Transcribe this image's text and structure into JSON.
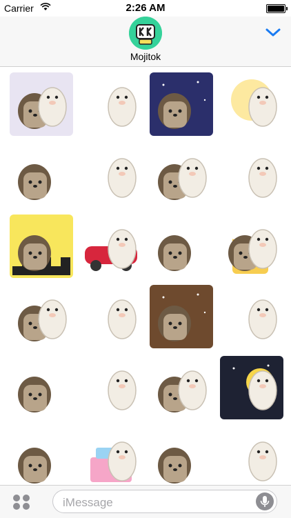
{
  "status_bar": {
    "carrier": "Carrier",
    "time": "2:26 AM",
    "wifi_icon": "wifi-icon",
    "battery_icon": "battery-icon",
    "battery_level": 1.0
  },
  "header": {
    "app_name": "Mojitok",
    "app_icon": "mojitok-logo-icon",
    "collapse_icon": "chevron-down-icon",
    "accent_color": "#1a7bf2"
  },
  "stickers": [
    {
      "name": "sticker-hedgehog-and-alpaca-kiss",
      "bg": "#e8e4f2"
    },
    {
      "name": "sticker-hedgehog-with-sunglasses",
      "bg": "#ffffff"
    },
    {
      "name": "sticker-hedgehog-sleeping-in-bed",
      "bg": "#2b2f6b"
    },
    {
      "name": "sticker-alpaca-sunshine",
      "bg": "#ffffff"
    },
    {
      "name": "sticker-hedgehog-superhero-flying",
      "bg": "#ffffff"
    },
    {
      "name": "sticker-alpaca-scared-hedgehog",
      "bg": "#ffffff"
    },
    {
      "name": "sticker-alpaca-hugging-crying-hedgehog",
      "bg": "#ffffff"
    },
    {
      "name": "sticker-alpaca-lifting-weights",
      "bg": "#ffffff"
    },
    {
      "name": "sticker-dancing-disco-floor",
      "bg": "#f8e65c"
    },
    {
      "name": "sticker-hedgehog-driving-red-car",
      "bg": "#ffffff"
    },
    {
      "name": "sticker-hedgehog-with-sunglasses-sweating",
      "bg": "#ffffff"
    },
    {
      "name": "sticker-hedgehog-in-beer-mug",
      "bg": "#ffffff"
    },
    {
      "name": "sticker-hedgehog-and-ghost",
      "bg": "#ffffff"
    },
    {
      "name": "sticker-alpaca-confused-question",
      "bg": "#ffffff"
    },
    {
      "name": "sticker-alpaca-peeking-from-wall",
      "bg": "#6e4a2e"
    },
    {
      "name": "sticker-hedgehog-working-at-desk",
      "bg": "#ffffff"
    },
    {
      "name": "sticker-alpaca-juggling-sweets",
      "bg": "#ffffff"
    },
    {
      "name": "sticker-alpaca-with-syringe",
      "bg": "#ffffff"
    },
    {
      "name": "sticker-hedgehog-sick-in-bed",
      "bg": "#ffffff"
    },
    {
      "name": "sticker-alpaca-moon-night",
      "bg": "#1e2233"
    },
    {
      "name": "sticker-hedgehog-skateboarding",
      "bg": "#ffffff"
    },
    {
      "name": "sticker-happy-birthday-cake",
      "bg": "#ffffff"
    },
    {
      "name": "sticker-hedgehog-with-gift",
      "bg": "#ffffff"
    },
    {
      "name": "sticker-hedgehog-angry-dark-aura",
      "bg": "#ffffff"
    }
  ],
  "bottom_bar": {
    "apps_icon": "app-drawer-icon",
    "placeholder": "iMessage",
    "mic_icon": "microphone-icon"
  }
}
